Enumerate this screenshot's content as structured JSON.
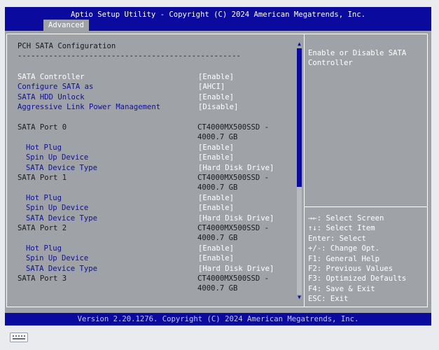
{
  "header": {
    "title": "Aptio Setup Utility - Copyright (C) 2024 American Megatrends, Inc.",
    "tab": "Advanced"
  },
  "main": {
    "heading": "PCH SATA Configuration",
    "rule": "--------------------------------------------------",
    "settings": [
      {
        "label": "SATA Controller",
        "value": "[Enable]"
      },
      {
        "label": "Configure SATA as",
        "value": "[AHCI]"
      },
      {
        "label": "SATA HDD Unlock",
        "value": "[Enable]"
      },
      {
        "label": "Aggressive Link Power Management",
        "value": "[Disable]"
      }
    ],
    "ports": [
      {
        "label": "SATA Port 0",
        "device_line1": "CT4000MX500SSD -",
        "device_line2": "4000.7 GB",
        "sub": [
          {
            "label": "Hot Plug",
            "value": "[Enable]"
          },
          {
            "label": "Spin Up Device",
            "value": "[Enable]"
          },
          {
            "label": "SATA Device Type",
            "value": "[Hard Disk Drive]"
          }
        ]
      },
      {
        "label": "SATA Port 1",
        "device_line1": "CT4000MX500SSD -",
        "device_line2": "4000.7 GB",
        "sub": [
          {
            "label": "Hot Plug",
            "value": "[Enable]"
          },
          {
            "label": "Spin Up Device",
            "value": "[Enable]"
          },
          {
            "label": "SATA Device Type",
            "value": "[Hard Disk Drive]"
          }
        ]
      },
      {
        "label": "SATA Port 2",
        "device_line1": "CT4000MX500SSD -",
        "device_line2": "4000.7 GB",
        "sub": [
          {
            "label": "Hot Plug",
            "value": "[Enable]"
          },
          {
            "label": "Spin Up Device",
            "value": "[Enable]"
          },
          {
            "label": "SATA Device Type",
            "value": "[Hard Disk Drive]"
          }
        ]
      },
      {
        "label": "SATA Port 3",
        "device_line1": "CT4000MX500SSD -",
        "device_line2": "4000.7 GB"
      }
    ]
  },
  "help": {
    "line1": "Enable or Disable SATA",
    "line2": "Controller"
  },
  "keys": [
    "→←: Select Screen",
    "↑↓: Select Item",
    "Enter: Select",
    "+/-: Change Opt.",
    "F1: General Help",
    "F2: Previous Values",
    "F3: Optimized Defaults",
    "F4: Save & Exit",
    "ESC: Exit"
  ],
  "footer": {
    "version": "Version 2.20.1276. Copyright (C) 2024 American Megatrends, Inc."
  },
  "colors": {
    "bar_blue": "#0a0a9e",
    "panel_gray": "#9fa3a7",
    "link_blue": "#101090",
    "text_white": "#ffffff"
  },
  "icons": {
    "scroll_up": "scroll-up-arrow-icon",
    "scroll_down": "scroll-down-arrow-icon",
    "keyboard": "keyboard-icon"
  }
}
